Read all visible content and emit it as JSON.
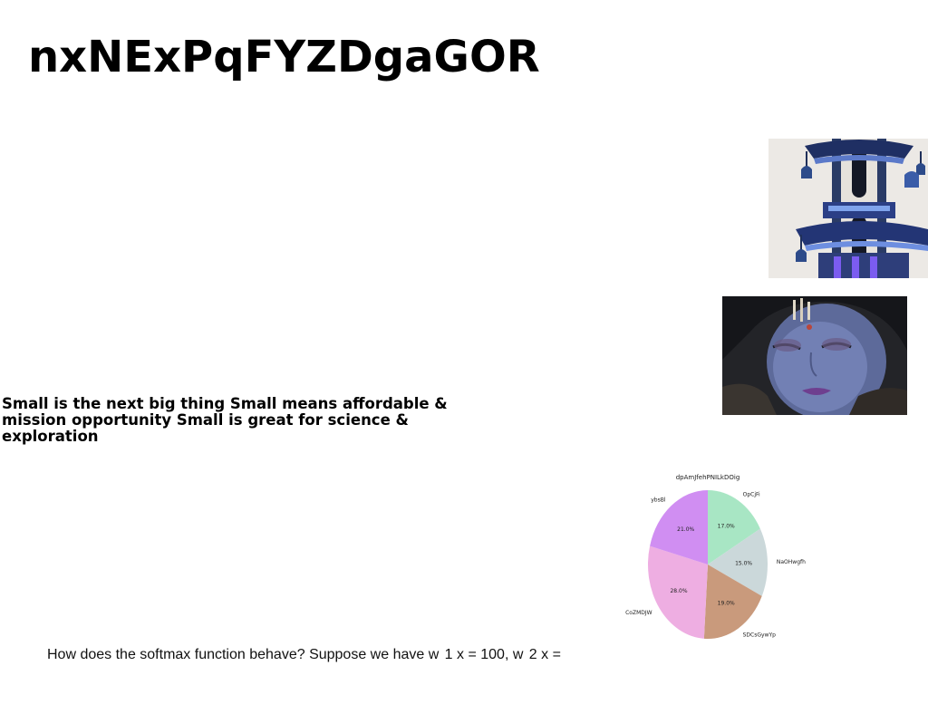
{
  "slide": {
    "title": "nxNExPqFYZDgaGOR",
    "body": "Small is the next big thing Small means affordable & mission opportunity Small is great for science & exploration",
    "question": "How does the softmax function behave? Suppose we have w  1 x = 100, w  2 x ="
  },
  "images": [
    {
      "name": "pagoda-photo"
    },
    {
      "name": "face-paint-photo"
    }
  ],
  "chart_data": {
    "type": "pie",
    "title": "dpAmJfehPNILkDOig",
    "categories": [
      "OpCjFi",
      "NaOHwgfh",
      "SDCsGywYp",
      "CoZMDJW",
      "ybsBl"
    ],
    "values": [
      17.0,
      15.0,
      19.0,
      28.0,
      21.0
    ],
    "value_labels": [
      "17.0%",
      "15.0%",
      "19.0%",
      "28.0%",
      "21.0%"
    ],
    "colors": [
      "#a8e6c4",
      "#cbd8da",
      "#c99a7c",
      "#eeaee2",
      "#d08ef2"
    ],
    "start_angle": 90,
    "direction": "clockwise"
  }
}
